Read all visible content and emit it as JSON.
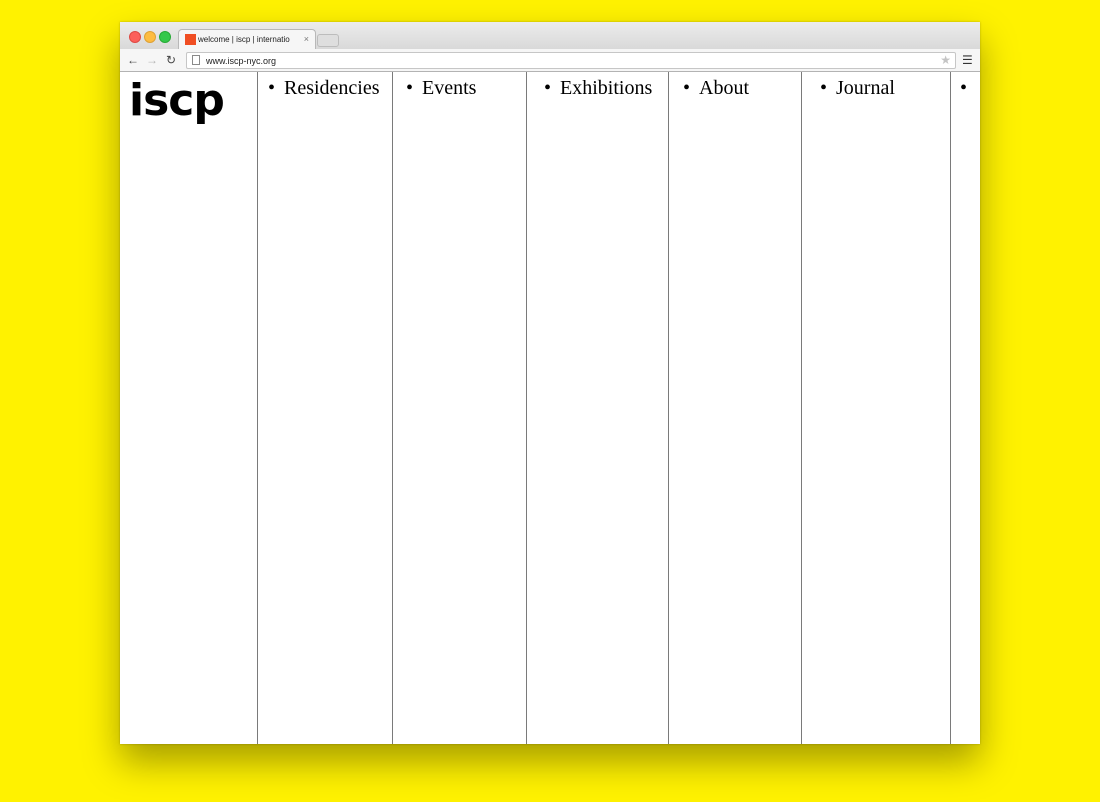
{
  "browser": {
    "tab_title": "welcome | iscp | internatio",
    "tab_close": "×",
    "url": "www.iscp-nyc.org"
  },
  "icons": {
    "back": "arrow-left-icon",
    "forward": "arrow-right-icon",
    "reload": "reload-icon",
    "page": "page-icon",
    "bookmark": "star-icon",
    "menu": "hamburger-menu-icon"
  },
  "site": {
    "logo": "iscp",
    "nav": [
      {
        "label": "Residencies"
      },
      {
        "label": "Events"
      },
      {
        "label": "Exhibitions"
      },
      {
        "label": "About"
      },
      {
        "label": "Journal"
      },
      {
        "label": ""
      }
    ]
  },
  "colors": {
    "background": "#FFF200",
    "favicon": "#F04E23"
  }
}
